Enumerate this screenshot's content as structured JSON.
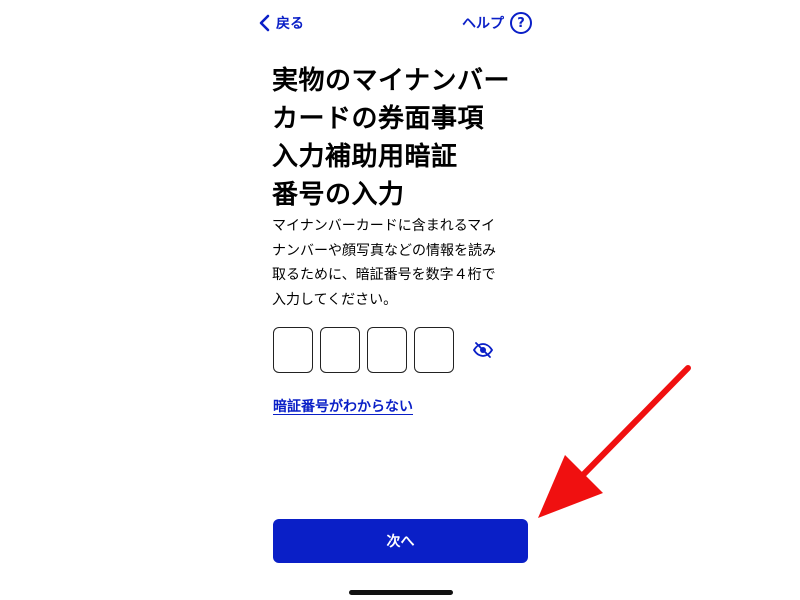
{
  "nav": {
    "back_label": "戻る",
    "help_label": "ヘルプ",
    "help_icon_glyph": "?"
  },
  "title_lines": [
    "実物のマイナンバー",
    "カードの券面事項",
    "入力補助用暗証",
    "番号の入力"
  ],
  "description_lines": [
    "マイナンバーカードに含まれるマイ",
    "ナンバーや顔写真などの情報を読み",
    "取るために、暗証番号を数字４桁で",
    "入力してください。"
  ],
  "pin": {
    "digits": [
      "",
      "",
      "",
      ""
    ]
  },
  "forgot_link": "暗証番号がわからない",
  "next_button": "次へ",
  "colors": {
    "accent": "#0a1fc7",
    "annotation_arrow": "#f01010"
  }
}
